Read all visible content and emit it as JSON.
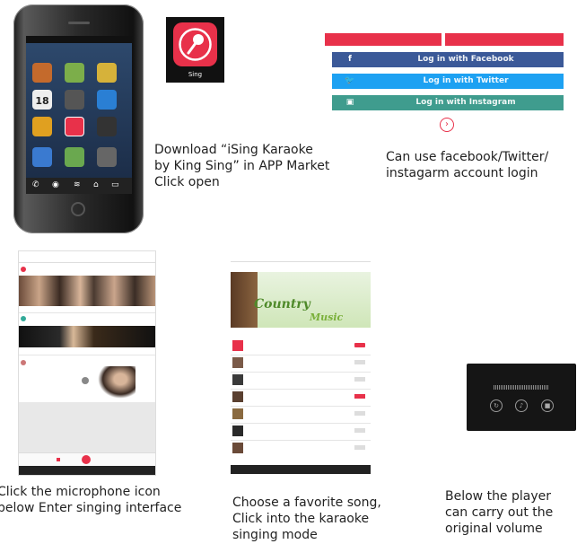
{
  "step1": {
    "caption_lines": [
      "Download “iSing Karaoke",
      "by King Sing” in APP Market",
      "Click open"
    ],
    "app_icon_label": "Sing",
    "phone_calendar_day": "18"
  },
  "step2": {
    "login_buttons": [
      {
        "label": "Log in with Facebook",
        "icon": "f",
        "color": "#3b5998"
      },
      {
        "label": "Log in with Twitter",
        "icon": "bird-icon",
        "color": "#1da1f2"
      },
      {
        "label": "Log in with Instagram",
        "icon": "camera-icon",
        "color": "#3f9c8e"
      }
    ],
    "caption_lines": [
      "Can use facebook/Twitter/",
      "instagarm account login"
    ]
  },
  "step3": {
    "caption_lines": [
      "Click the microphone icon",
      "below Enter singing interface"
    ]
  },
  "step4": {
    "banner_text_1": "Country",
    "banner_text_2": "Music",
    "caption_lines": [
      "Choose a favorite song,",
      "Click into the karaoke",
      "singing mode"
    ]
  },
  "step5": {
    "caption_lines": [
      "Below the player",
      "can carry out the",
      "original volume"
    ]
  },
  "colors": {
    "accent": "#e8314a",
    "facebook": "#3b5998",
    "twitter": "#1da1f2",
    "instagram": "#3f9c8e"
  }
}
